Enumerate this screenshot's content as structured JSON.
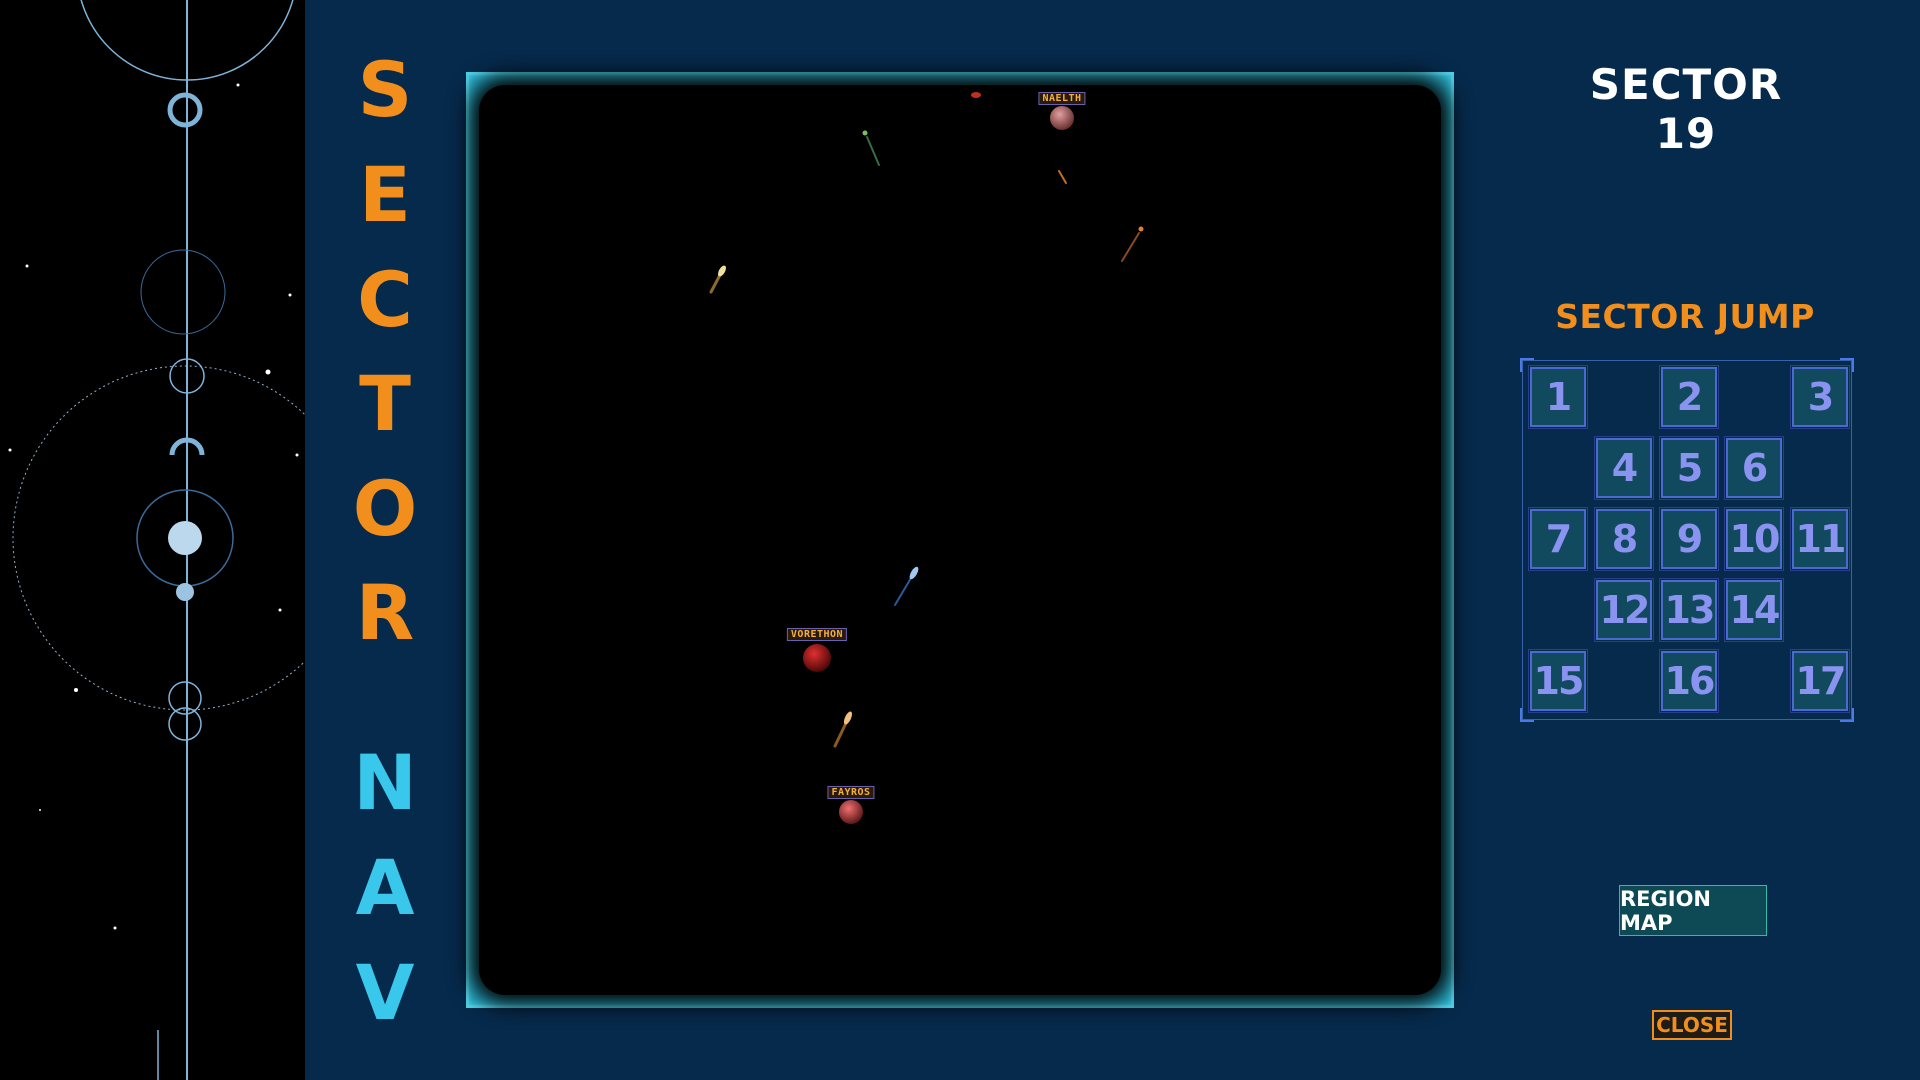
{
  "title_letters": [
    "S",
    "E",
    "C",
    "T",
    "O",
    "R",
    "N",
    "A",
    "V"
  ],
  "header": {
    "sector_title": "SECTOR 19"
  },
  "map": {
    "planets": [
      {
        "name": "NAELTH",
        "color": "#c07a7a"
      },
      {
        "name": "VORETHON",
        "color": "#b01818"
      },
      {
        "name": "FAYROS",
        "color": "#c84040"
      }
    ]
  },
  "jump": {
    "title": "SECTOR JUMP",
    "sectors": [
      "1",
      "2",
      "3",
      "4",
      "5",
      "6",
      "7",
      "8",
      "9",
      "10",
      "11",
      "12",
      "13",
      "14",
      "15",
      "16",
      "17"
    ]
  },
  "buttons": {
    "region_map": "REGION MAP",
    "close": "CLOSE"
  },
  "colors": {
    "orange": "#f28e1c",
    "cyan": "#39c8ec",
    "panel_bg": "#062a4c",
    "frame": "#4fd6ec"
  }
}
